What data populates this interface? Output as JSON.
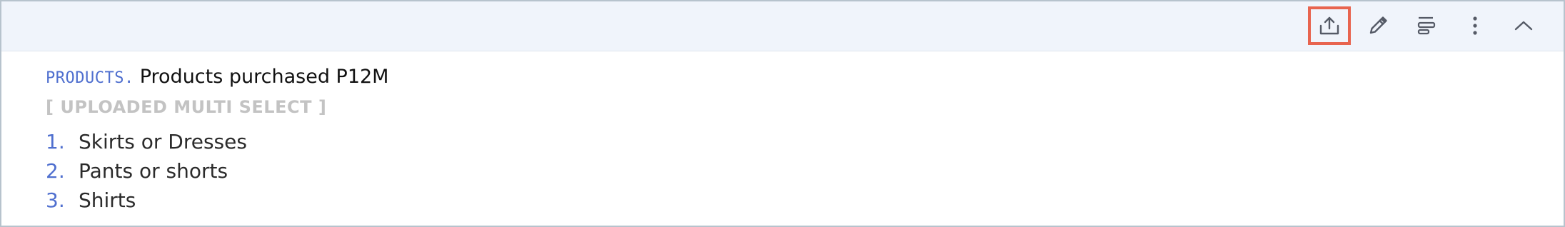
{
  "toolbar": {
    "icons": [
      {
        "name": "upload-icon",
        "highlighted": true
      },
      {
        "name": "pencil-icon",
        "highlighted": false
      },
      {
        "name": "align-left-icon",
        "highlighted": false
      },
      {
        "name": "more-vertical-icon",
        "highlighted": false
      },
      {
        "name": "chevron-up-icon",
        "highlighted": false
      }
    ],
    "highlight_color": "#e8644f",
    "icon_color": "#555a66"
  },
  "question": {
    "code": "PRODUCTS.",
    "text": "Products purchased P12M",
    "type_label": "[ UPLOADED MULTI SELECT ]",
    "options": [
      {
        "number": "1.",
        "label": "Skirts or Dresses"
      },
      {
        "number": "2.",
        "label": "Pants or shorts"
      },
      {
        "number": "3.",
        "label": "Shirts"
      }
    ]
  },
  "colors": {
    "accent": "#4f6fcf",
    "toolbar_bg": "#f0f4fb",
    "border": "#b7c3cd",
    "type_label": "#c3c3c3"
  }
}
